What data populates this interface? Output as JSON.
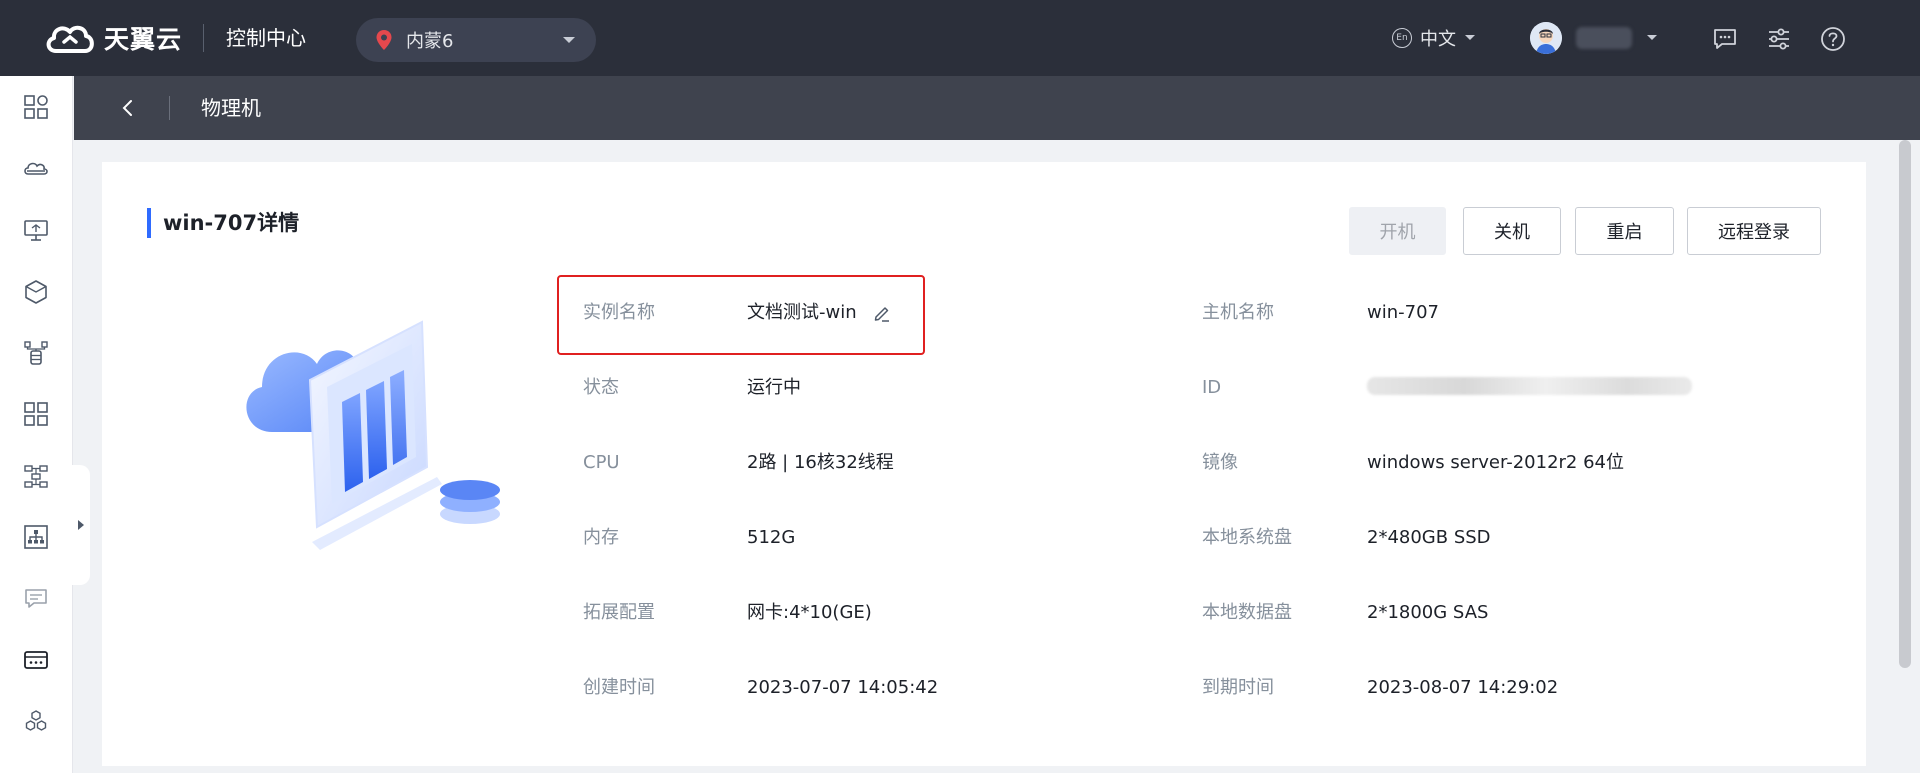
{
  "header": {
    "logo_text": "天翼云",
    "console_title": "控制中心",
    "region": "内蒙6",
    "lang_badge": "En",
    "lang": "中文"
  },
  "subheader": {
    "title": "物理机"
  },
  "detail": {
    "title": "win-707详情",
    "buttons": {
      "power_on": "开机",
      "power_off": "关机",
      "restart": "重启",
      "remote_login": "远程登录"
    },
    "left_fields": [
      {
        "label": "实例名称",
        "value": "文档测试-win"
      },
      {
        "label": "状态",
        "value": "运行中"
      },
      {
        "label": "CPU",
        "value": "2路 | 16核32线程"
      },
      {
        "label": "内存",
        "value": "512G"
      },
      {
        "label": "拓展配置",
        "value": "网卡:4*10(GE)"
      },
      {
        "label": "创建时间",
        "value": "2023-07-07 14:05:42"
      }
    ],
    "right_fields": [
      {
        "label": "主机名称",
        "value": "win-707"
      },
      {
        "label": "ID",
        "value": ""
      },
      {
        "label": "镜像",
        "value": "windows server-2012r2 64位"
      },
      {
        "label": "本地系统盘",
        "value": "2*480GB SSD"
      },
      {
        "label": "本地数据盘",
        "value": "2*1800G SAS"
      },
      {
        "label": "到期时间",
        "value": "2023-08-07 14:29:02"
      }
    ]
  },
  "colors": {
    "topbar": "#2b2f3a",
    "subheader": "#3f434e",
    "accent": "#2f6bff",
    "highlight": "#e02020",
    "region_pin": "#e5484d"
  },
  "icons": {
    "sidebar": [
      "dashboard-grid-icon",
      "cloud-icon",
      "monitor-icon",
      "cube-icon",
      "database-network-icon",
      "apps-grid-icon",
      "topology-icon",
      "org-chart-icon",
      "message-icon",
      "server-card-icon",
      "hexagon-cluster-icon"
    ],
    "top": [
      "message-icon",
      "settings-sliders-icon",
      "help-icon"
    ]
  }
}
